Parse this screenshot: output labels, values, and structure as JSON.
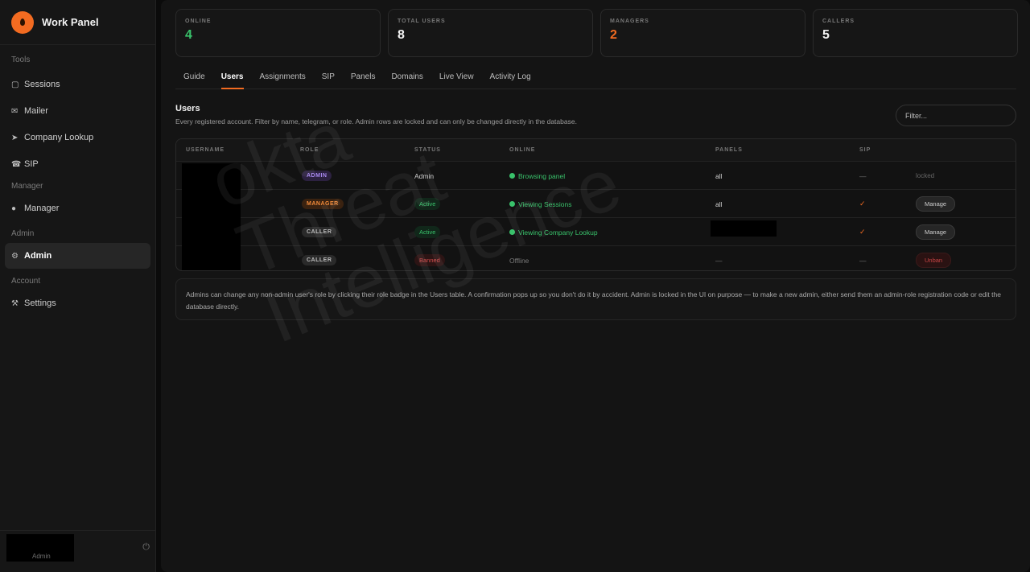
{
  "brand": {
    "title": "Work Panel"
  },
  "sidebar": {
    "sections": [
      {
        "label": "Tools",
        "items": [
          {
            "label": "Sessions",
            "icon": "clipboard-icon"
          },
          {
            "label": "Mailer",
            "icon": "envelope-icon"
          },
          {
            "label": "Company Lookup",
            "icon": "satellite-icon"
          },
          {
            "label": "SIP",
            "icon": "phone-icon"
          }
        ]
      },
      {
        "label": "Manager",
        "items": [
          {
            "label": "Manager",
            "icon": "people-icon"
          }
        ]
      },
      {
        "label": "Admin",
        "items": [
          {
            "label": "Admin",
            "icon": "gear-icon",
            "active": true
          }
        ]
      },
      {
        "label": "Account",
        "items": [
          {
            "label": "Settings",
            "icon": "tools-icon"
          }
        ]
      }
    ],
    "user": {
      "role": "Admin"
    }
  },
  "stats": [
    {
      "label": "ONLINE",
      "value": "4",
      "color": "#39c26b"
    },
    {
      "label": "TOTAL USERS",
      "value": "8",
      "color": "#f2f2f2"
    },
    {
      "label": "MANAGERS",
      "value": "2",
      "color": "#f26b21"
    },
    {
      "label": "CALLERS",
      "value": "5",
      "color": "#f2f2f2"
    }
  ],
  "tabs": [
    "Guide",
    "Users",
    "Assignments",
    "SIP",
    "Panels",
    "Domains",
    "Live View",
    "Activity Log"
  ],
  "active_tab": "Users",
  "users": {
    "title": "Users",
    "subtitle": "Every registered account. Filter by name, telegram, or role. Admin rows are locked and can only be changed directly in the database.",
    "filter_placeholder": "Filter...",
    "columns": [
      "USERNAME",
      "ROLE",
      "STATUS",
      "ONLINE",
      "PANELS",
      "SIP"
    ],
    "rows": [
      {
        "role": "ADMIN",
        "status": "Admin",
        "online": "Browsing panel",
        "panels": "all",
        "sip": "—",
        "action": "locked"
      },
      {
        "role": "MANAGER",
        "status": "Active",
        "online": "Viewing Sessions",
        "panels": "all",
        "sip": "✓",
        "action": "Manage"
      },
      {
        "role": "CALLER",
        "status": "Active",
        "online": "Viewing Company Lookup",
        "panels": "",
        "sip": "✓",
        "action": "Manage"
      },
      {
        "role": "CALLER",
        "status": "Banned",
        "online": "Offline",
        "panels": "—",
        "sip": "—",
        "action": "Unban"
      }
    ]
  },
  "note": "Admins can change any non-admin user's role by clicking their role badge in the Users table. A confirmation pops up so you don't do it by accident. Admin is locked in the UI on purpose — to make a new admin, either send them an admin-role registration code or edit the database directly.",
  "watermark": [
    "okta",
    "Threat",
    "Intelligence"
  ]
}
